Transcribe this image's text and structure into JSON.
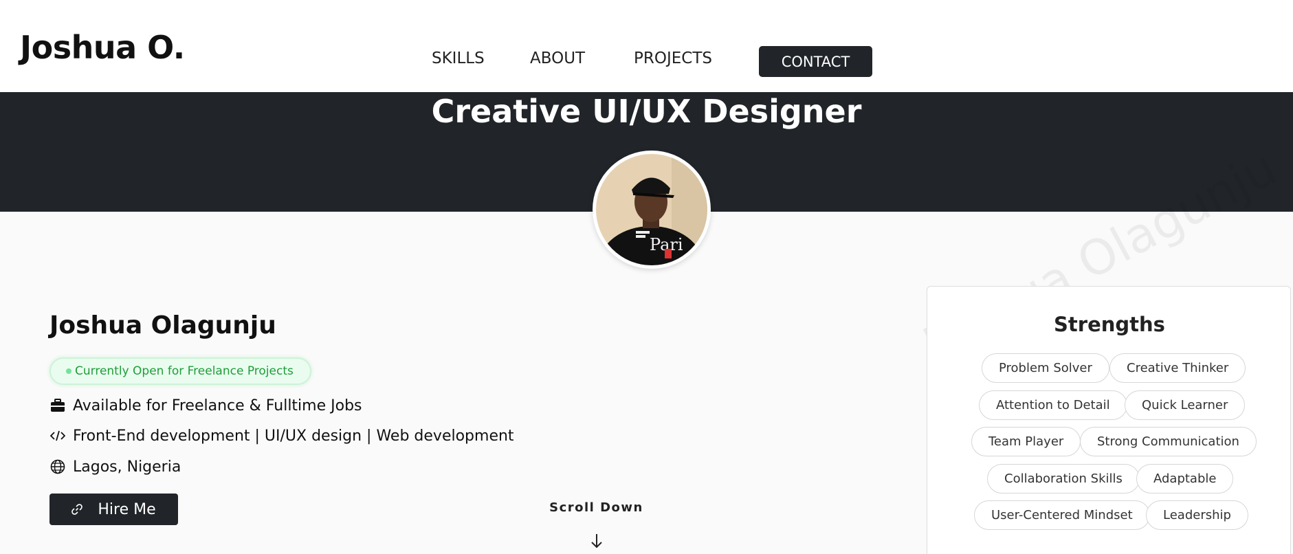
{
  "header": {
    "logo": "Joshua O.",
    "nav": [
      "SKILLS",
      "ABOUT",
      "PROJECTS"
    ],
    "contact_label": "CONTACT"
  },
  "hero": {
    "title": "Creative UI/UX Designer",
    "avatar_icon": "profile-photo"
  },
  "profile": {
    "name": "Joshua Olagunju",
    "status": "Currently Open for Freelance Projects",
    "availability": "Available for Freelance & Fulltime Jobs",
    "roles": "Front-End development | UI/UX design | Web development",
    "location": "Lagos, Nigeria",
    "hire_label": "Hire Me",
    "status_color": "#1f9d3a"
  },
  "scroll": {
    "label": "Scroll Down"
  },
  "strengths": {
    "title": "Strengths",
    "chips": [
      "Problem Solver",
      "Creative Thinker",
      "Attention to Detail",
      "Quick Learner",
      "Team Player",
      "Strong Communication",
      "Collaboration Skills",
      "Adaptable",
      "User-Centered Mindset",
      "Leadership"
    ]
  },
  "watermark": "Joshua Olagunju",
  "colors": {
    "dark": "#212529",
    "background": "#fafafa"
  }
}
